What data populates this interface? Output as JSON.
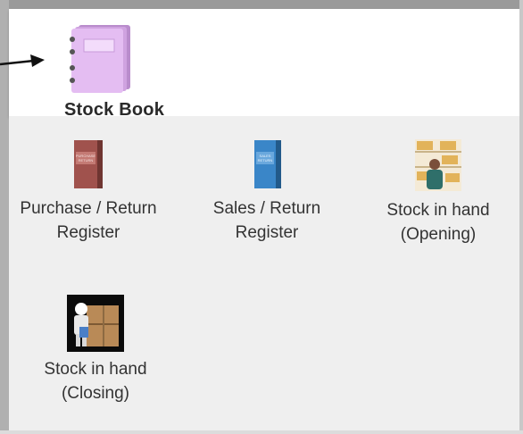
{
  "header": {
    "title": "Stock Book",
    "icon": "stock-book-icon"
  },
  "tiles": [
    {
      "label_line1": "Purchase / Return",
      "label_line2": "Register",
      "icon": "purchase-register-book-icon"
    },
    {
      "label_line1": "Sales / Return",
      "label_line2": "Register",
      "icon": "sales-register-book-icon"
    },
    {
      "label_line1": "Stock in hand",
      "label_line2": "(Opening)",
      "icon": "stock-opening-shelves-icon"
    },
    {
      "label_line1": "Stock in hand",
      "label_line2": "(Closing)",
      "icon": "stock-closing-boxes-icon"
    }
  ],
  "colors": {
    "purchase_book": "#a0524d",
    "sales_book": "#3a86c8",
    "stock_book": "#d8a6e8",
    "grid_background": "#efefef"
  }
}
